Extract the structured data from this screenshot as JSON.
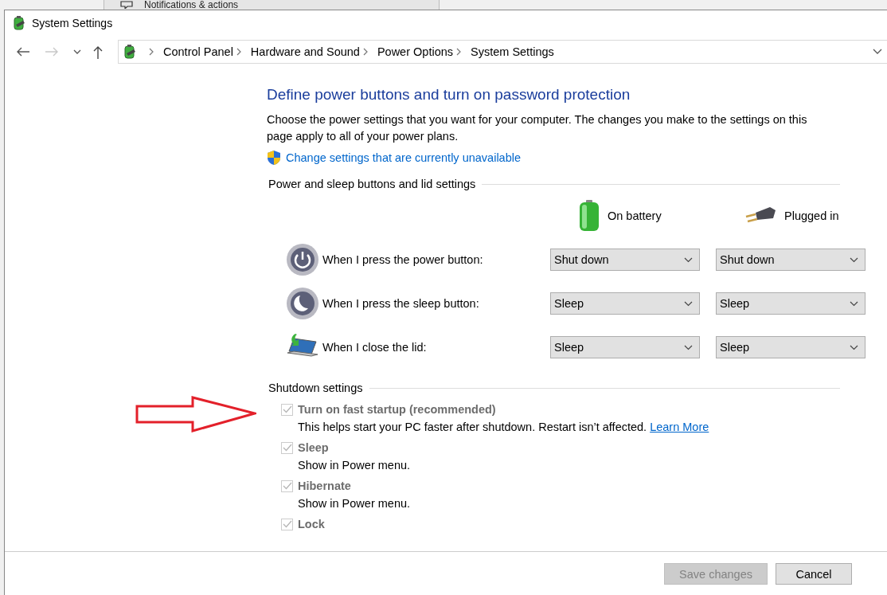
{
  "background_window": {
    "title": "Notifications & actions"
  },
  "window": {
    "title": "System Settings"
  },
  "nav": {
    "back": {
      "disabled": false
    },
    "forward": {
      "disabled": true
    }
  },
  "breadcrumb": [
    "Control Panel",
    "Hardware and Sound",
    "Power Options",
    "System Settings"
  ],
  "heading": "Define power buttons and turn on password protection",
  "description": "Choose the power settings that you want for your computer. The changes you make to the settings on this page apply to all of your power plans.",
  "admin_link": "Change settings that are currently unavailable",
  "buttons_section": {
    "title": "Power and sleep buttons and lid settings",
    "columns": [
      {
        "label": "On battery",
        "kind": "battery"
      },
      {
        "label": "Plugged in",
        "kind": "plug"
      }
    ],
    "rows": [
      {
        "kind": "power",
        "label": "When I press the power button:",
        "values": [
          "Shut down",
          "Shut down"
        ]
      },
      {
        "kind": "sleep",
        "label": "When I press the sleep button:",
        "values": [
          "Sleep",
          "Sleep"
        ]
      },
      {
        "kind": "lid",
        "label": "When I close the lid:",
        "values": [
          "Sleep",
          "Sleep"
        ]
      }
    ]
  },
  "shutdown_section": {
    "title": "Shutdown settings",
    "options": [
      {
        "label": "Turn on fast startup (recommended)",
        "description": "This helps start your PC faster after shutdown. Restart isn’t affected.",
        "link": "Learn More",
        "checked": true,
        "disabled": true
      },
      {
        "label": "Sleep",
        "description": "Show in Power menu.",
        "checked": true,
        "disabled": true
      },
      {
        "label": "Hibernate",
        "description": "Show in Power menu.",
        "checked": true,
        "disabled": true
      },
      {
        "label": "Lock",
        "checked": true,
        "disabled": true
      }
    ]
  },
  "footer": {
    "buttons": [
      {
        "label": "Save changes",
        "disabled": true
      },
      {
        "label": "Cancel",
        "disabled": false
      }
    ]
  }
}
